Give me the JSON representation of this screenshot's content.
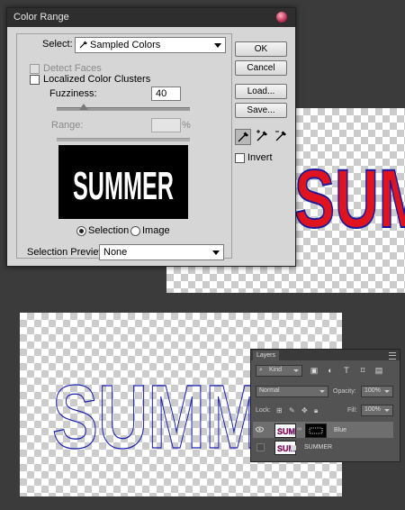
{
  "dialog": {
    "title": "Color Range",
    "select_label": "Select:",
    "select_value": "Sampled Colors",
    "detect_faces_label": "Detect Faces",
    "localized_label": "Localized Color Clusters",
    "fuzziness_label": "Fuzziness:",
    "fuzziness_value": "40",
    "fuzziness_fraction": 0.2,
    "range_label": "Range:",
    "range_unit": "%",
    "preview_text": "SUMMER",
    "selection_radio_label": "Selection",
    "image_radio_label": "Image",
    "selection_preview_label": "Selection Preview:",
    "selection_preview_value": "None",
    "buttons": {
      "ok": "OK",
      "cancel": "Cancel",
      "load": "Load...",
      "save": "Save..."
    },
    "invert_label": "Invert",
    "tools": [
      "eyedropper-icon",
      "eyedropper-plus-icon",
      "eyedropper-minus-icon"
    ]
  },
  "canvas_top": {
    "text": "SUMMER",
    "fill_color": "#e0141e",
    "stroke_color": "#1a1aa0"
  },
  "canvas_bottom": {
    "text": "SUMMER",
    "stroke_color": "#1c24b4"
  },
  "layers_panel": {
    "tab_label": "Layers",
    "filter_value": "Kind",
    "blend_mode": "Normal",
    "opacity_label": "Opacity:",
    "opacity_value": "100%",
    "lock_label": "Lock:",
    "fill_label": "Fill:",
    "fill_value": "100%",
    "layers": [
      {
        "name": "Blue",
        "visible": true,
        "selected": true
      },
      {
        "name": "SUMMER",
        "visible": false,
        "selected": false
      }
    ]
  }
}
